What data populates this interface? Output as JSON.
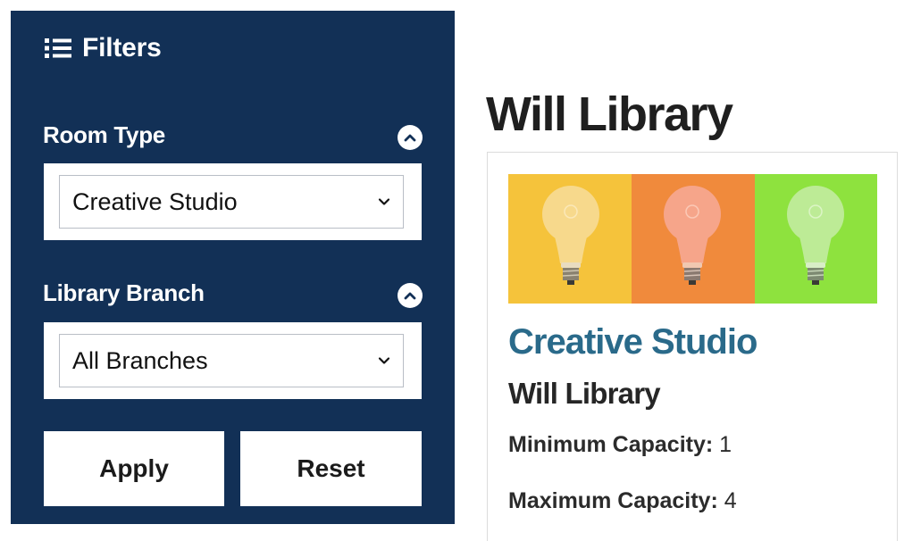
{
  "filters": {
    "title": "Filters",
    "icon": "list-icon",
    "room_type": {
      "label": "Room Type",
      "selected": "Creative Studio",
      "toggle_icon": "chevron-up-icon"
    },
    "library_branch": {
      "label": "Library Branch",
      "selected": "All Branches",
      "toggle_icon": "chevron-up-icon"
    },
    "apply_label": "Apply",
    "reset_label": "Reset"
  },
  "result": {
    "branch_heading": "Will Library",
    "card": {
      "image_icon": "light-bulbs-image",
      "room_name": "Creative Studio",
      "branch": "Will Library",
      "min_capacity_label": "Minimum Capacity:",
      "min_capacity_value": "1",
      "max_capacity_label": "Maximum Capacity:",
      "max_capacity_value": "4"
    }
  },
  "colors": {
    "panel_bg": "#123056",
    "room_name": "#2a6a8a",
    "bulb_panel_1": "#f5c33b",
    "bulb_panel_2": "#f08a3c",
    "bulb_panel_3": "#8ee23e"
  }
}
